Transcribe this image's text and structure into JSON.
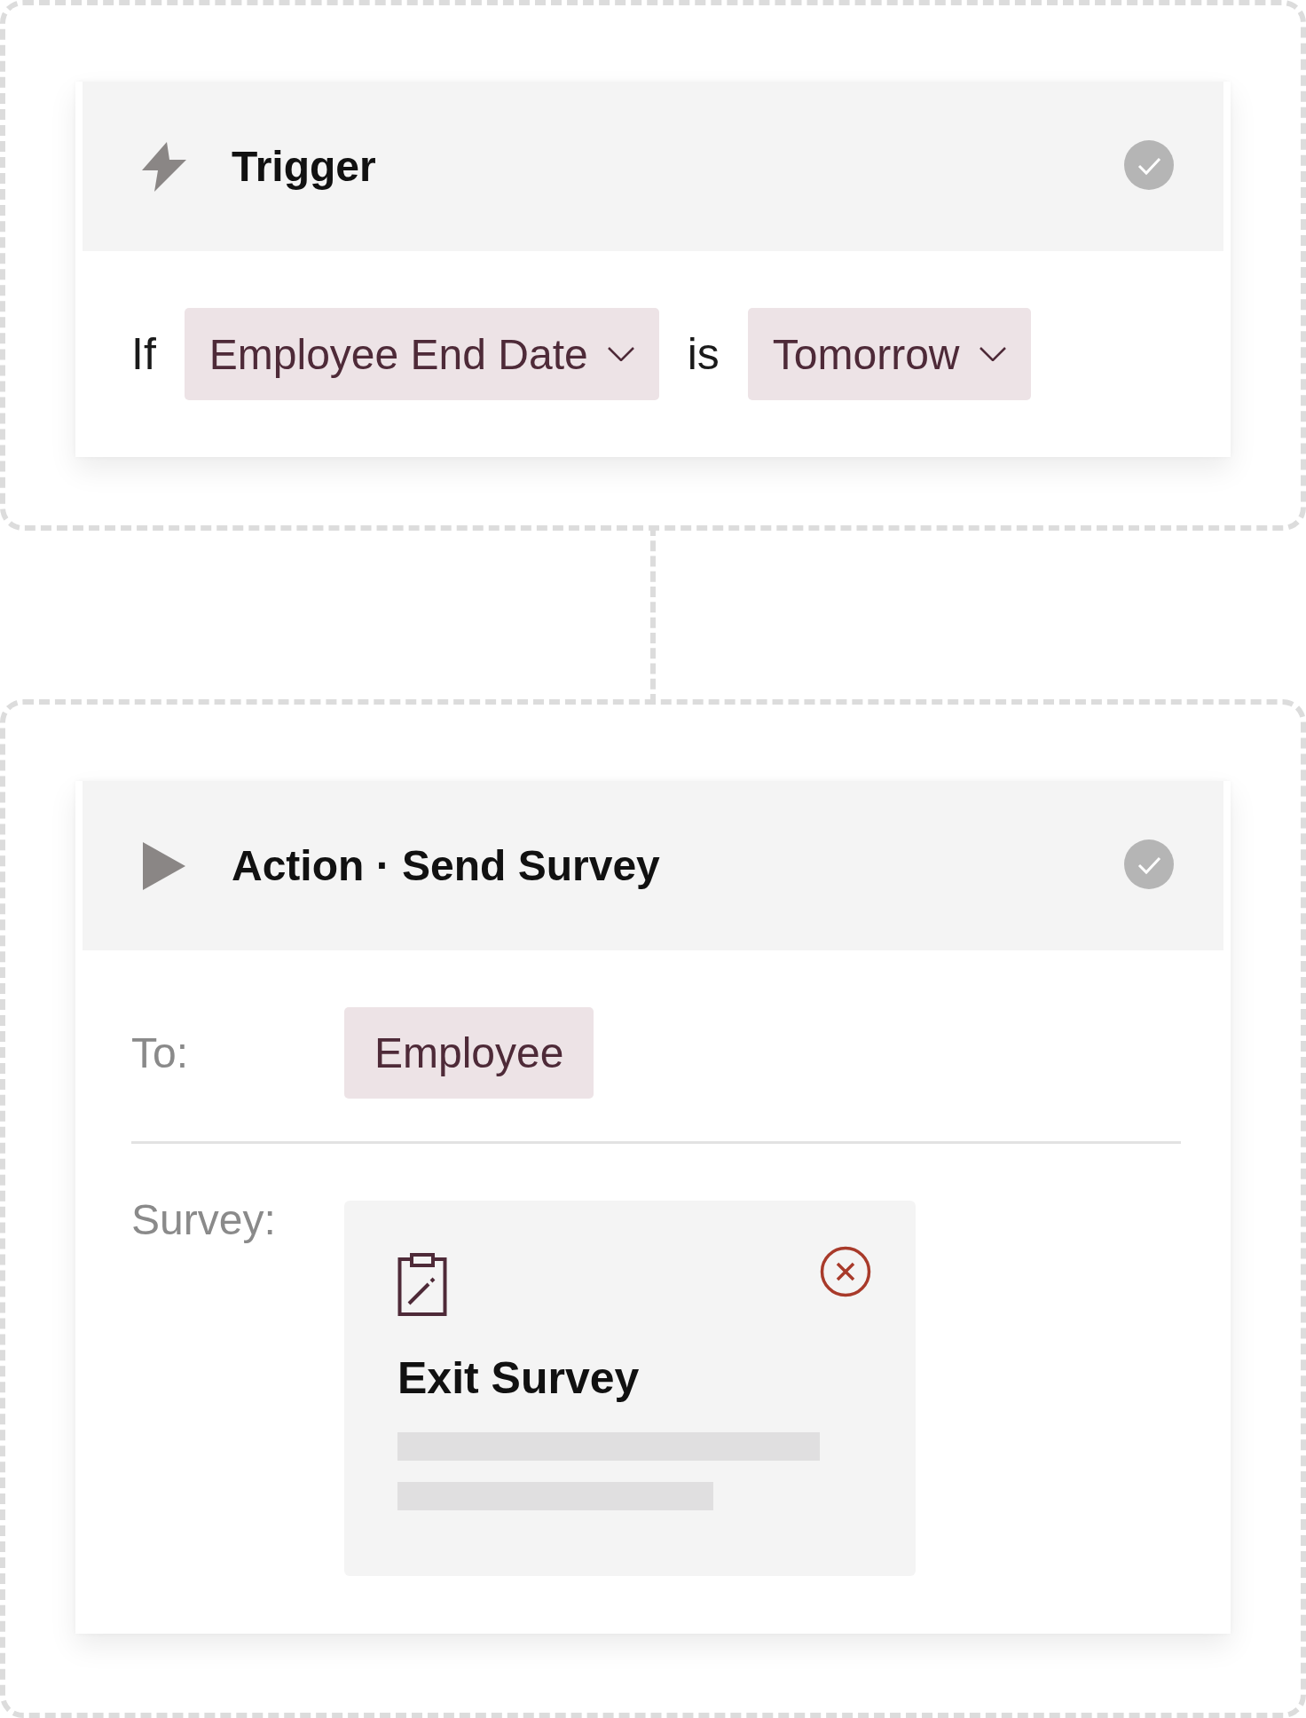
{
  "trigger": {
    "title": "Trigger",
    "completed": true,
    "condition": [
      {
        "kind": "text",
        "text": "If"
      },
      {
        "kind": "dropdown",
        "text": "Employee End Date"
      },
      {
        "kind": "text",
        "text": "is"
      },
      {
        "kind": "dropdown",
        "text": "Tomorrow"
      }
    ]
  },
  "action": {
    "title": "Action · Send Survey",
    "completed": true,
    "to_label": "To:",
    "recipient": "Employee",
    "survey_label": "Survey:",
    "survey": {
      "title": "Exit Survey"
    }
  }
}
